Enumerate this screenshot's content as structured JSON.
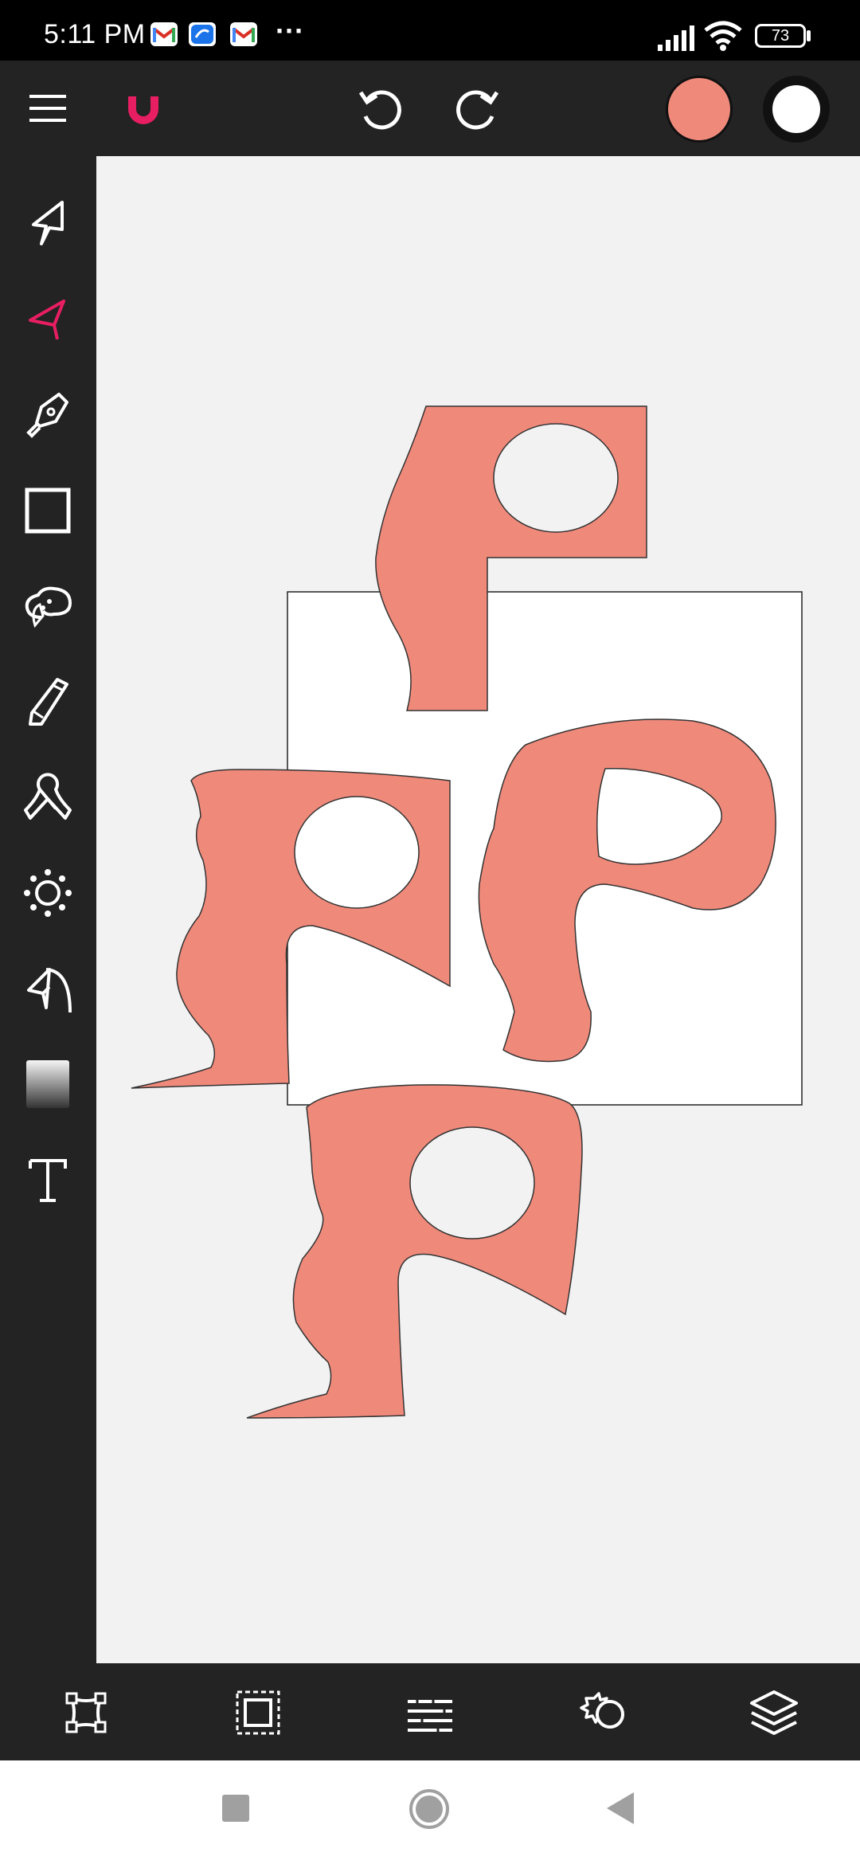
{
  "status_bar": {
    "time": "5:11 PM",
    "more": "···",
    "battery": "73",
    "notifications": [
      "gmail-icon",
      "app-icon",
      "gmail-icon"
    ]
  },
  "top_toolbar": {
    "icons": [
      "menu-icon",
      "magnet-icon",
      "undo-icon",
      "redo-icon"
    ],
    "fill_color": "#ef8a7b",
    "stroke_color": "#ffffff"
  },
  "left_tools": [
    "select-tool",
    "direct-select-tool",
    "pen-tool",
    "rectangle-tool",
    "lasso-tool",
    "pencil-tool",
    "ribbon-tool",
    "gear-shape-tool",
    "arrow-path-tool",
    "gradient-tool",
    "text-tool"
  ],
  "active_tool": "direct-select-tool",
  "accent_color": "#e81e63",
  "canvas": {
    "background": "#f2f2f2",
    "shape_fill": "#ef8a7b",
    "artboard_fill": "#ffffff"
  },
  "floating_actions": [
    "delete-icon",
    "hand-icon",
    "scissors-icon",
    "knife-icon"
  ],
  "bottom_tools": [
    "transform-icon",
    "crop-select-icon",
    "align-icon",
    "settings-shape-icon",
    "layers-icon"
  ],
  "nav_bar": [
    "recents-button",
    "home-button",
    "back-button"
  ]
}
